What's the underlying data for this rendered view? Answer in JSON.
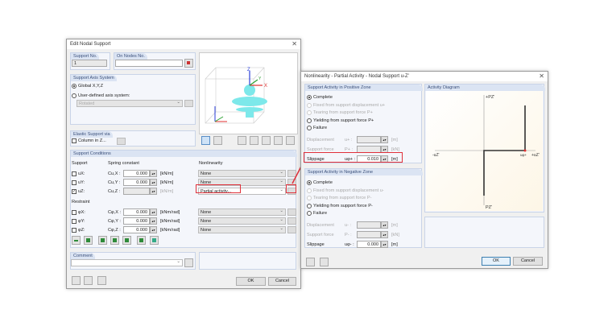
{
  "main_dialog": {
    "title": "Edit Nodal Support",
    "support_no": {
      "label": "Support No.",
      "value": "1"
    },
    "on_nodes": {
      "label": "On Nodes No.",
      "value": ""
    },
    "axis_system": {
      "label": "Support Axis System",
      "global": "Global X,Y,Z",
      "user_defined": "User-defined axis system:",
      "rotated": "Rotated",
      "selected": "global"
    },
    "elastic": {
      "label": "Elastic Support via",
      "column": "Column in Z..."
    },
    "preview_axes": {
      "z": "Z",
      "y": "Y",
      "x": "X"
    },
    "conditions": {
      "label": "Support Conditions",
      "col_support": "Support",
      "col_spring": "Spring constant",
      "col_nonlin": "Nonlinearity",
      "restraint": "Restraint",
      "rows": [
        {
          "name": "uX:",
          "sym": "Cu,X :",
          "value": "0.000",
          "unit": "[kN/m]",
          "nonlin": "None",
          "checked": false
        },
        {
          "name": "uY:",
          "sym": "Cu,Y :",
          "value": "0.000",
          "unit": "[kN/m]",
          "nonlin": "None",
          "checked": false
        },
        {
          "name": "uZ:",
          "sym": "Cu,Z :",
          "value": "",
          "unit": "[kN/m]",
          "nonlin": "Partial activity...",
          "checked": true
        },
        {
          "name": "φX:",
          "sym": "Cφ,X :",
          "value": "0.000",
          "unit": "[kNm/rad]",
          "nonlin": "None",
          "checked": false
        },
        {
          "name": "φY:",
          "sym": "Cφ,Y :",
          "value": "0.000",
          "unit": "[kNm/rad]",
          "nonlin": "None",
          "checked": false
        },
        {
          "name": "φZ:",
          "sym": "Cφ,Z :",
          "value": "0.000",
          "unit": "[kNm/rad]",
          "nonlin": "None",
          "checked": false
        }
      ]
    },
    "comment": {
      "label": "Comment",
      "value": ""
    },
    "ok": "OK",
    "cancel": "Cancel"
  },
  "nl_dialog": {
    "title": "Nonlinearity - Partial Activity - Nodal Support u-Z'",
    "positive": {
      "label": "Support Activity in Positive Zone",
      "options": [
        "Complete",
        "Fixed from support displacement u+",
        "Tearing from support force P+",
        "Yielding from support force P+",
        "Failure"
      ],
      "displacement": {
        "label": "Displacement",
        "sym": "u+ :",
        "unit": "[m]"
      },
      "force": {
        "label": "Support force",
        "sym": "P+ :",
        "unit": "[kN]"
      },
      "slippage": {
        "label": "Slippage",
        "sym": "uφ+ :",
        "value": "0.010",
        "unit": "[m]"
      }
    },
    "negative": {
      "label": "Support Activity in Negative Zone",
      "options": [
        "Complete",
        "Fixed from support displacement u-",
        "Tearing from support force P-",
        "Yielding from support force P-",
        "Failure"
      ],
      "displacement": {
        "label": "Displacement",
        "sym": "u- :",
        "unit": "[m]"
      },
      "force": {
        "label": "Support force",
        "sym": "P- :",
        "unit": "[kN]"
      },
      "slippage": {
        "label": "Slippage",
        "sym": "uφ- :",
        "value": "0.000",
        "unit": "[m]"
      }
    },
    "diagram": {
      "label": "Activity Diagram",
      "pz_pos": "+PZ'",
      "pz_neg": "PZ'",
      "uz_neg": "-uZ'",
      "uz_pos": "+uZ'",
      "slip": "uφ+"
    },
    "ok": "OK",
    "cancel": "Cancel"
  },
  "colors": {
    "highlight": "#e0303a",
    "group_header": "#dbe4f3",
    "support_cyan": "#7de8ea"
  }
}
